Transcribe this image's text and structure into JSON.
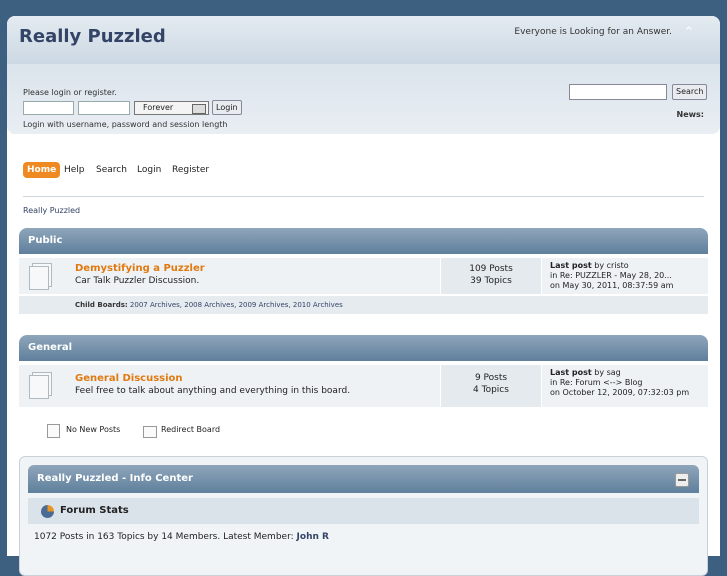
{
  "header": {
    "title": "Really Puzzled",
    "slogan": "Everyone is Looking for an Answer."
  },
  "login": {
    "prompt": "Please login or register.",
    "session_value": "Forever",
    "login_label": "Login",
    "hint": "Login with username, password and session length"
  },
  "search": {
    "button_label": "Search",
    "news_label": "News:"
  },
  "menu": [
    "Home",
    "Help",
    "Search",
    "Login",
    "Register"
  ],
  "breadcrumb": "Really Puzzled",
  "categories": [
    {
      "name": "Public",
      "boards": [
        {
          "name": "Demystifying a Puzzler",
          "description": "Car Talk Puzzler Discussion.",
          "posts": "109 Posts",
          "topics": "39 Topics",
          "last_post_label": "Last post",
          "last_post_by": "by cristo",
          "last_post_in": "in Re: PUZZLER - May 28, 20...",
          "last_post_on": "on May 30, 2011, 08:37:59 am",
          "child_label": "Child Boards:",
          "child_boards": "2007 Archives, 2008 Archives, 2009 Archives, 2010 Archives"
        }
      ]
    },
    {
      "name": "General",
      "boards": [
        {
          "name": "General Discussion",
          "description": "Feel free to talk about anything and everything in this board.",
          "posts": "9 Posts",
          "topics": "4 Topics",
          "last_post_label": "Last post",
          "last_post_by": "by sag",
          "last_post_in": "in Re: Forum <--> Blog",
          "last_post_on": "on October 12, 2009, 07:32:03 pm"
        }
      ]
    }
  ],
  "legend": {
    "no_new": "No New Posts",
    "redirect": "Redirect Board"
  },
  "info_center": {
    "title": "Really Puzzled - Info Center",
    "stats_title": "Forum Stats",
    "stats_text": "1072 Posts in 163 Topics by 14 Members. Latest Member:",
    "latest_member": "John R"
  }
}
